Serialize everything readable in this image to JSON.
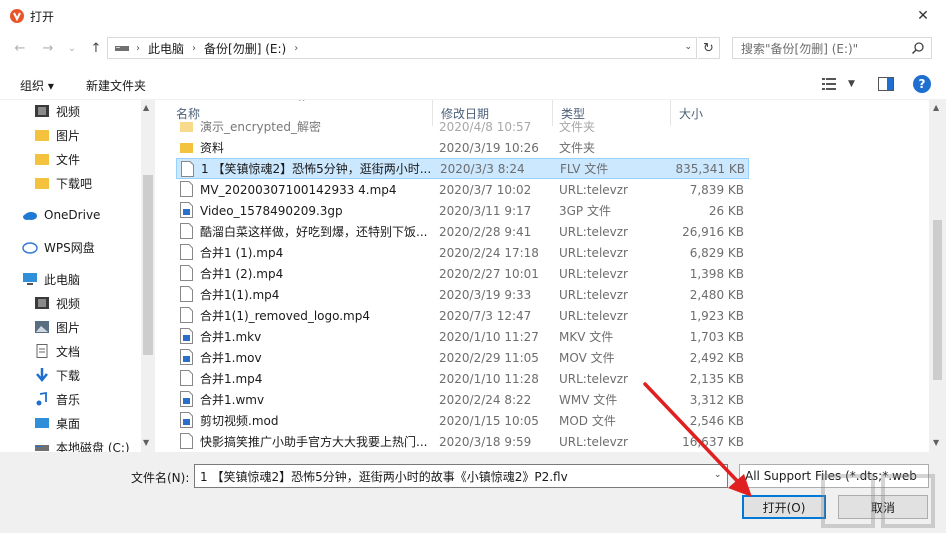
{
  "window": {
    "title": "打开",
    "close": "✕"
  },
  "nav": {
    "back": "←",
    "forward": "→",
    "recent": "⌄",
    "up": "↑",
    "breadcrumbs": [
      "此电脑",
      "备份[勿删] (E:)"
    ],
    "search_placeholder": "搜索\"备份[勿删] (E:)\""
  },
  "toolbar": {
    "organize": "组织 ▾",
    "new_folder": "新建文件夹",
    "help": "?"
  },
  "sidebar": {
    "items": [
      {
        "label": "视频",
        "icon": "video-icon"
      },
      {
        "label": "图片",
        "icon": "folder-icon"
      },
      {
        "label": "文件",
        "icon": "folder-icon"
      },
      {
        "label": "下载吧",
        "icon": "folder-icon"
      },
      {
        "label": "OneDrive",
        "icon": "cloud-icon"
      },
      {
        "label": "WPS网盘",
        "icon": "wps-cloud-icon"
      },
      {
        "label": "此电脑",
        "icon": "computer-icon"
      },
      {
        "label": "视频",
        "icon": "video-icon"
      },
      {
        "label": "图片",
        "icon": "picture-icon"
      },
      {
        "label": "文档",
        "icon": "document-icon"
      },
      {
        "label": "下载",
        "icon": "download-icon"
      },
      {
        "label": "音乐",
        "icon": "music-icon"
      },
      {
        "label": "桌面",
        "icon": "desktop-icon"
      },
      {
        "label": "本地磁盘 (C:)",
        "icon": "drive-icon"
      }
    ]
  },
  "columns": {
    "name": "名称",
    "date": "修改日期",
    "type": "类型",
    "size": "大小"
  },
  "files": [
    {
      "name": "演示_encrypted_解密",
      "date": "2020/4/8 10:57",
      "type": "文件夹",
      "size": "",
      "icon": "folder-icon"
    },
    {
      "name": "资料",
      "date": "2020/3/19 10:26",
      "type": "文件夹",
      "size": "",
      "icon": "folder-icon"
    },
    {
      "name": "1 【笑镇惊魂2】恐怖5分钟，逛街两小时...",
      "date": "2020/3/3 8:24",
      "type": "FLV 文件",
      "size": "835,341 KB",
      "icon": "file-icon"
    },
    {
      "name": "MV_20200307100142933 4.mp4",
      "date": "2020/3/7 10:02",
      "type": "URL:televzr",
      "size": "7,839 KB",
      "icon": "file-icon"
    },
    {
      "name": "Video_1578490209.3gp",
      "date": "2020/3/11 9:17",
      "type": "3GP 文件",
      "size": "26 KB",
      "icon": "media-file-icon"
    },
    {
      "name": "酷溜白菜这样做，好吃到爆，还特别下饭...",
      "date": "2020/2/28 9:41",
      "type": "URL:televzr",
      "size": "26,916 KB",
      "icon": "file-icon"
    },
    {
      "name": "合并1 (1).mp4",
      "date": "2020/2/24 17:18",
      "type": "URL:televzr",
      "size": "6,829 KB",
      "icon": "file-icon"
    },
    {
      "name": "合并1 (2).mp4",
      "date": "2020/2/27 10:01",
      "type": "URL:televzr",
      "size": "1,398 KB",
      "icon": "file-icon"
    },
    {
      "name": "合并1(1).mp4",
      "date": "2020/3/19 9:33",
      "type": "URL:televzr",
      "size": "2,480 KB",
      "icon": "file-icon"
    },
    {
      "name": "合并1(1)_removed_logo.mp4",
      "date": "2020/7/3 12:47",
      "type": "URL:televzr",
      "size": "1,923 KB",
      "icon": "file-icon"
    },
    {
      "name": "合并1.mkv",
      "date": "2020/1/10 11:27",
      "type": "MKV 文件",
      "size": "1,703 KB",
      "icon": "media-file-icon"
    },
    {
      "name": "合并1.mov",
      "date": "2020/2/29 11:05",
      "type": "MOV 文件",
      "size": "2,492 KB",
      "icon": "media-file-icon"
    },
    {
      "name": "合并1.mp4",
      "date": "2020/1/10 11:28",
      "type": "URL:televzr",
      "size": "2,135 KB",
      "icon": "file-icon"
    },
    {
      "name": "合并1.wmv",
      "date": "2020/2/24 8:22",
      "type": "WMV 文件",
      "size": "3,312 KB",
      "icon": "media-file-icon"
    },
    {
      "name": "剪切视频.mod",
      "date": "2020/1/15 10:05",
      "type": "MOD 文件",
      "size": "2,546 KB",
      "icon": "media-file-icon"
    },
    {
      "name": "快影搞笑推广小助手官方大大我要上热门...",
      "date": "2020/3/18 9:59",
      "type": "URL:televzr",
      "size": "16,637 KB",
      "icon": "file-icon"
    }
  ],
  "footer": {
    "filename_label": "文件名(N):",
    "filename_value": "1 【笑镇惊魂2】恐怖5分钟，逛街两小时的故事《小镇惊魂2》P2.flv",
    "filter_value": "All Support Files (*.dts;*.web",
    "open": "打开(O)",
    "cancel": "取消"
  },
  "colors": {
    "accent": "#0078d7",
    "selection": "#cce8ff",
    "arrow": "#e02020",
    "folder": "#f3c33e"
  }
}
